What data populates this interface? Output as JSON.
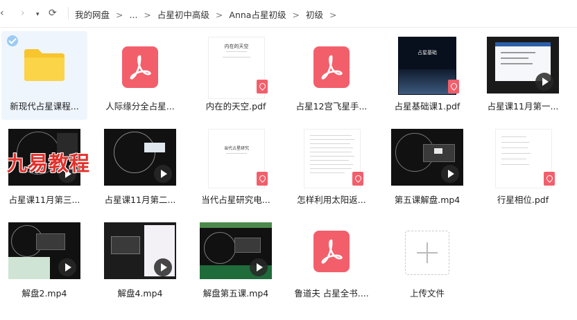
{
  "nav": {
    "back_icon": "‹",
    "forward_icon": "›",
    "history_icon": "▾",
    "refresh_icon": "⟳"
  },
  "breadcrumb": [
    "我的网盘",
    "...",
    "占星初中高级",
    "Anna占星初级",
    "初级"
  ],
  "breadcrumb_sep": ">",
  "files": [
    {
      "name": "新现代占星课程...",
      "type": "folder"
    },
    {
      "name": "人际缘分全占星...",
      "type": "pdf"
    },
    {
      "name": "内在的天空.pdf",
      "type": "pdf-doc",
      "thumb_title": "内在的天空"
    },
    {
      "name": "占星12宫飞星手...",
      "type": "pdf"
    },
    {
      "name": "占星基础课1.pdf",
      "type": "pdf-dark",
      "thumb_title": "占星基础"
    },
    {
      "name": "占星课11月第一...",
      "type": "video"
    },
    {
      "name": "占星课11月第三...",
      "type": "video"
    },
    {
      "name": "占星课11月第二...",
      "type": "video"
    },
    {
      "name": "当代占星研究电...",
      "type": "pdf-doc",
      "thumb_title": "当代占星研究"
    },
    {
      "name": "怎样利用太阳返...",
      "type": "pdf-doc"
    },
    {
      "name": "第五课解盘.mp4",
      "type": "video"
    },
    {
      "name": "行星相位.pdf",
      "type": "pdf-doc"
    },
    {
      "name": "解盘2.mp4",
      "type": "video"
    },
    {
      "name": "解盘4.mp4",
      "type": "video"
    },
    {
      "name": "解盘第五课.mp4",
      "type": "video"
    },
    {
      "name": "鲁道夫 占星全书....",
      "type": "pdf"
    },
    {
      "name": "上传文件",
      "type": "upload"
    }
  ],
  "watermark": "九易教程",
  "colors": {
    "pdf": "#f25f6b",
    "folder": "#f9cf3a",
    "selected": "#eef5fd",
    "watermark": "#e2312c"
  }
}
